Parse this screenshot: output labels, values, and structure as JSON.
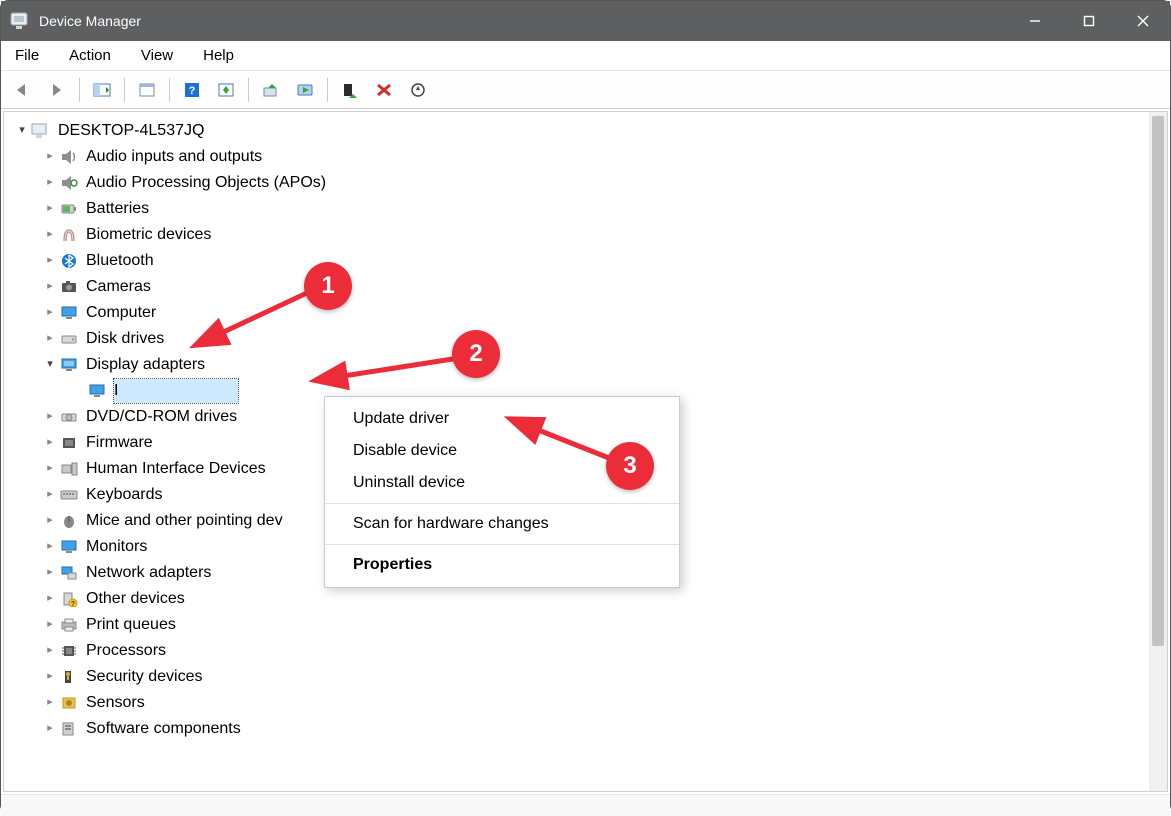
{
  "window": {
    "title": "Device Manager"
  },
  "menu": {
    "file": "File",
    "action": "Action",
    "view": "View",
    "help": "Help"
  },
  "tree": {
    "root": "DESKTOP-4L537JQ",
    "items": [
      "Audio inputs and outputs",
      "Audio Processing Objects (APOs)",
      "Batteries",
      "Biometric devices",
      "Bluetooth",
      "Cameras",
      "Computer",
      "Disk drives",
      "Display adapters",
      "DVD/CD-ROM drives",
      "Firmware",
      "Human Interface Devices",
      "Keyboards",
      "Mice and other pointing dev",
      "Monitors",
      "Network adapters",
      "Other devices",
      "Print queues",
      "Processors",
      "Security devices",
      "Sensors",
      "Software components"
    ],
    "display_child": "I"
  },
  "context_menu": {
    "update": "Update driver",
    "disable": "Disable device",
    "uninstall": "Uninstall device",
    "scan": "Scan for hardware changes",
    "properties": "Properties"
  },
  "annotations": {
    "b1": "1",
    "b2": "2",
    "b3": "3"
  }
}
